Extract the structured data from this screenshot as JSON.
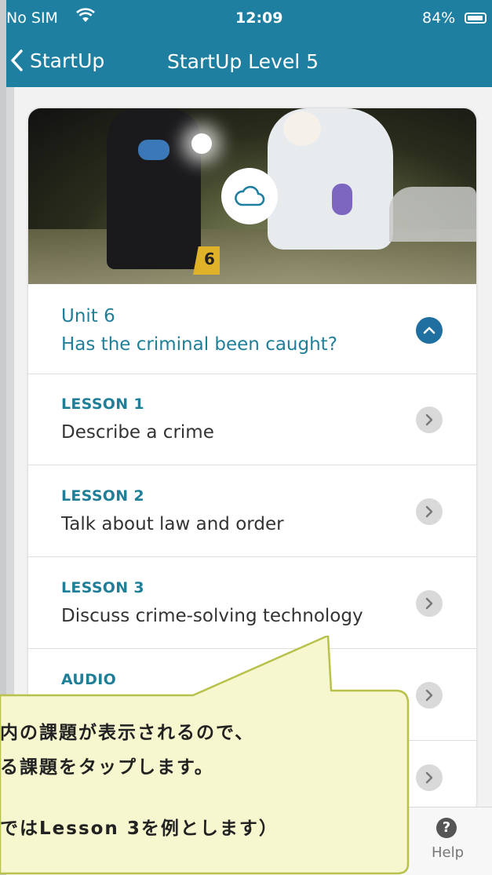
{
  "status": {
    "carrier": "No SIM",
    "time": "12:09",
    "battery": "84%"
  },
  "nav": {
    "back_label": "StartUp",
    "title": "StartUp Level 5"
  },
  "unit": {
    "line1": "Unit 6",
    "line2": "Has the criminal been caught?"
  },
  "hero": {
    "marker_label": "6"
  },
  "lessons": [
    {
      "label": "LESSON 1",
      "desc": "Describe a crime"
    },
    {
      "label": "LESSON 2",
      "desc": "Talk about law and order"
    },
    {
      "label": "LESSON 3",
      "desc": "Discuss crime-solving technology"
    },
    {
      "label": "AUDIO",
      "desc": ""
    }
  ],
  "help": {
    "icon": "?",
    "label": "Help"
  },
  "callout": {
    "line1": "内の課題が表示されるので、",
    "line2": "る課題をタップします。",
    "line3": "ではLesson 3を例とします）"
  },
  "colors": {
    "accent": "#1f7fa0",
    "callout_bg": "#f6f6cf",
    "callout_border": "#b8c24a"
  }
}
